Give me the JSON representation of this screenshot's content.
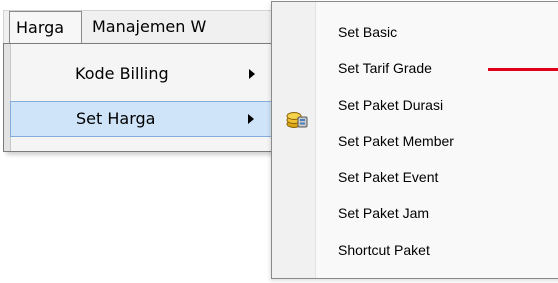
{
  "menubar": {
    "items": [
      {
        "label": "Harga"
      },
      {
        "label": "Manajemen W"
      }
    ]
  },
  "dropdown": {
    "items": [
      {
        "label": "Kode Billing",
        "has_submenu": true,
        "highlighted": false
      },
      {
        "label": "Set Harga",
        "has_submenu": true,
        "highlighted": true
      }
    ]
  },
  "submenu": {
    "items": [
      {
        "label": "Set Basic"
      },
      {
        "label": "Set Tarif Grade"
      },
      {
        "label": "Set Paket Durasi",
        "icon": "coins-icon"
      },
      {
        "label": "Set Paket Member"
      },
      {
        "label": "Set Paket Event"
      },
      {
        "label": "Set Paket Jam"
      },
      {
        "label": "Shortcut Paket"
      }
    ]
  },
  "colors": {
    "highlight_fill": "#cfe4f8",
    "highlight_border": "#84acdd",
    "annotation_line": "#e0001b"
  }
}
